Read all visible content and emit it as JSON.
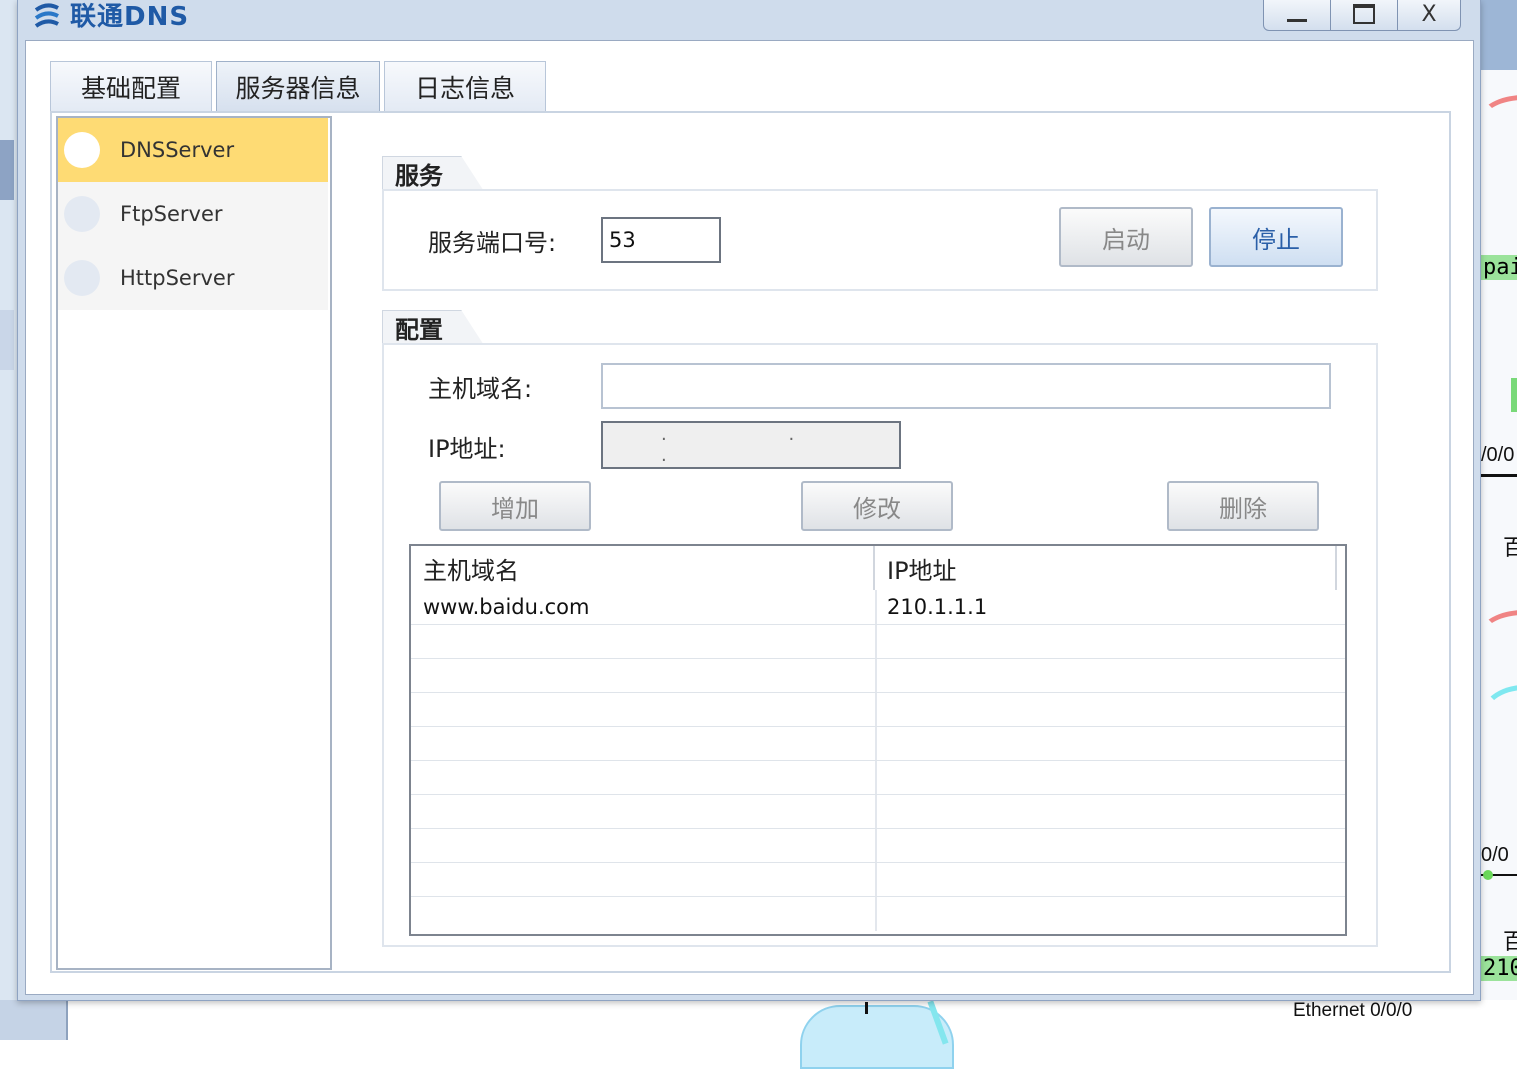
{
  "window": {
    "title": "联通DNS",
    "icon": "dns-app-icon",
    "minimize_label": "",
    "maximize_label": "",
    "close_label": "X"
  },
  "tabs": [
    {
      "label": "基础配置",
      "active": false
    },
    {
      "label": "服务器信息",
      "active": true
    },
    {
      "label": "日志信息",
      "active": false
    }
  ],
  "sidebar": {
    "items": [
      {
        "label": "DNSServer",
        "selected": true
      },
      {
        "label": "FtpServer",
        "selected": false
      },
      {
        "label": "HttpServer",
        "selected": false
      }
    ]
  },
  "service": {
    "title": "服务",
    "port_label": "服务端口号:",
    "port_value": "53",
    "start_label": "启动",
    "stop_label": "停止"
  },
  "config": {
    "title": "配置",
    "host_label": "主机域名:",
    "host_value": "",
    "ip_label": "IP地址:",
    "ip_value": ". . .",
    "add_label": "增加",
    "modify_label": "修改",
    "delete_label": "删除"
  },
  "table": {
    "columns": [
      "主机域名",
      "IP地址"
    ],
    "rows": [
      {
        "host": "www.baidu.com",
        "ip": "210.1.1.1"
      }
    ],
    "empty_rows": 9
  },
  "background": {
    "tag_top": "pai",
    "port_a": "/0/0",
    "char_a": "百",
    "port_b": "0/0",
    "char_b": "百",
    "tag_bottom": "210",
    "eth_label": "Ethernet 0/0/0"
  },
  "colors": {
    "selected_item": "#fedb74",
    "title_text": "#1f5aa6",
    "stop_button_text": "#2a5fa8"
  }
}
